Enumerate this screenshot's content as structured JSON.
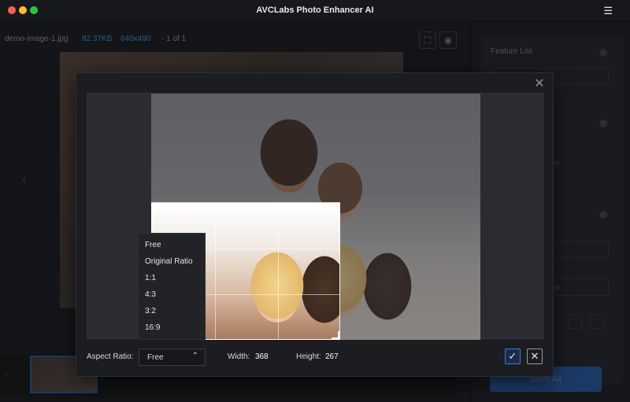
{
  "app": {
    "title": "AVCLabs Photo Enhancer AI",
    "menu_icon": "hamburger-menu-icon"
  },
  "info_bar": {
    "filename": "demo-image-1.jpg",
    "filesize": "82.37KB",
    "dimensions": "640x480",
    "page": "1 of 1"
  },
  "side_panel": {
    "feature_list_label": "Feature List",
    "format_hint": "e forma",
    "partial_text": "nt",
    "save_all_label": "Save All"
  },
  "crop_dialog": {
    "close_icon": "close-icon",
    "aspect_ratio_label": "Aspect Ratio:",
    "aspect_ratio_value": "Free",
    "aspect_ratio_options": [
      "Free",
      "Original Ratio",
      "1:1",
      "4:3",
      "3:2",
      "16:9"
    ],
    "width_label": "Width:",
    "width_value": "368",
    "height_label": "Height:",
    "height_value": "267",
    "confirm_icon": "check-icon",
    "cancel_icon": "close-icon"
  },
  "colors": {
    "accent": "#3a7be0",
    "background": "#141518",
    "modal_bg": "#1c1d21"
  }
}
